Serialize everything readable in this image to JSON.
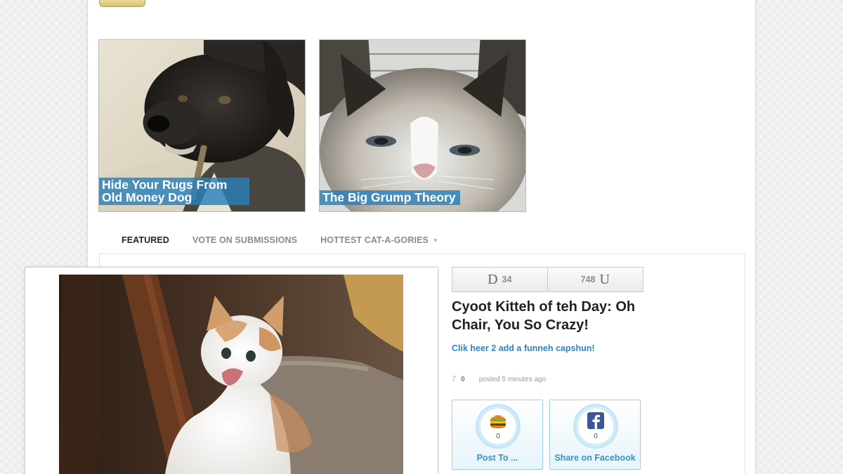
{
  "features": [
    {
      "caption": "Hide Your Rugs From Old Money Dog"
    },
    {
      "caption": "The Big Grump Theory"
    }
  ],
  "nav": {
    "featured": "FEATURED",
    "vote": "VOTE ON SUBMISSIONS",
    "hottest": "HOTTEST CAT-A-GORIES",
    "hottest_caret": "▼"
  },
  "post": {
    "vote_down_letter": "D",
    "vote_down_count": "34",
    "vote_up_count": "748",
    "vote_up_letter": "U",
    "title": "Cyoot Kitteh of teh Day: Oh Chair, You So Crazy!",
    "caption_link": "Clik heer 2 add a funneh capshun!",
    "comment_icon": "7",
    "comment_count": "0",
    "posted": "posted 5 minutes ago"
  },
  "share": {
    "post_count": "0",
    "post_label": "Post To ...",
    "fb_count": "0",
    "fb_label": "Share on Facebook"
  },
  "colors": {
    "caption_bg": "#2980b9",
    "link_blue": "#2b86c5",
    "share_blue": "#3b91c3",
    "facebook_blue": "#3b5998"
  }
}
